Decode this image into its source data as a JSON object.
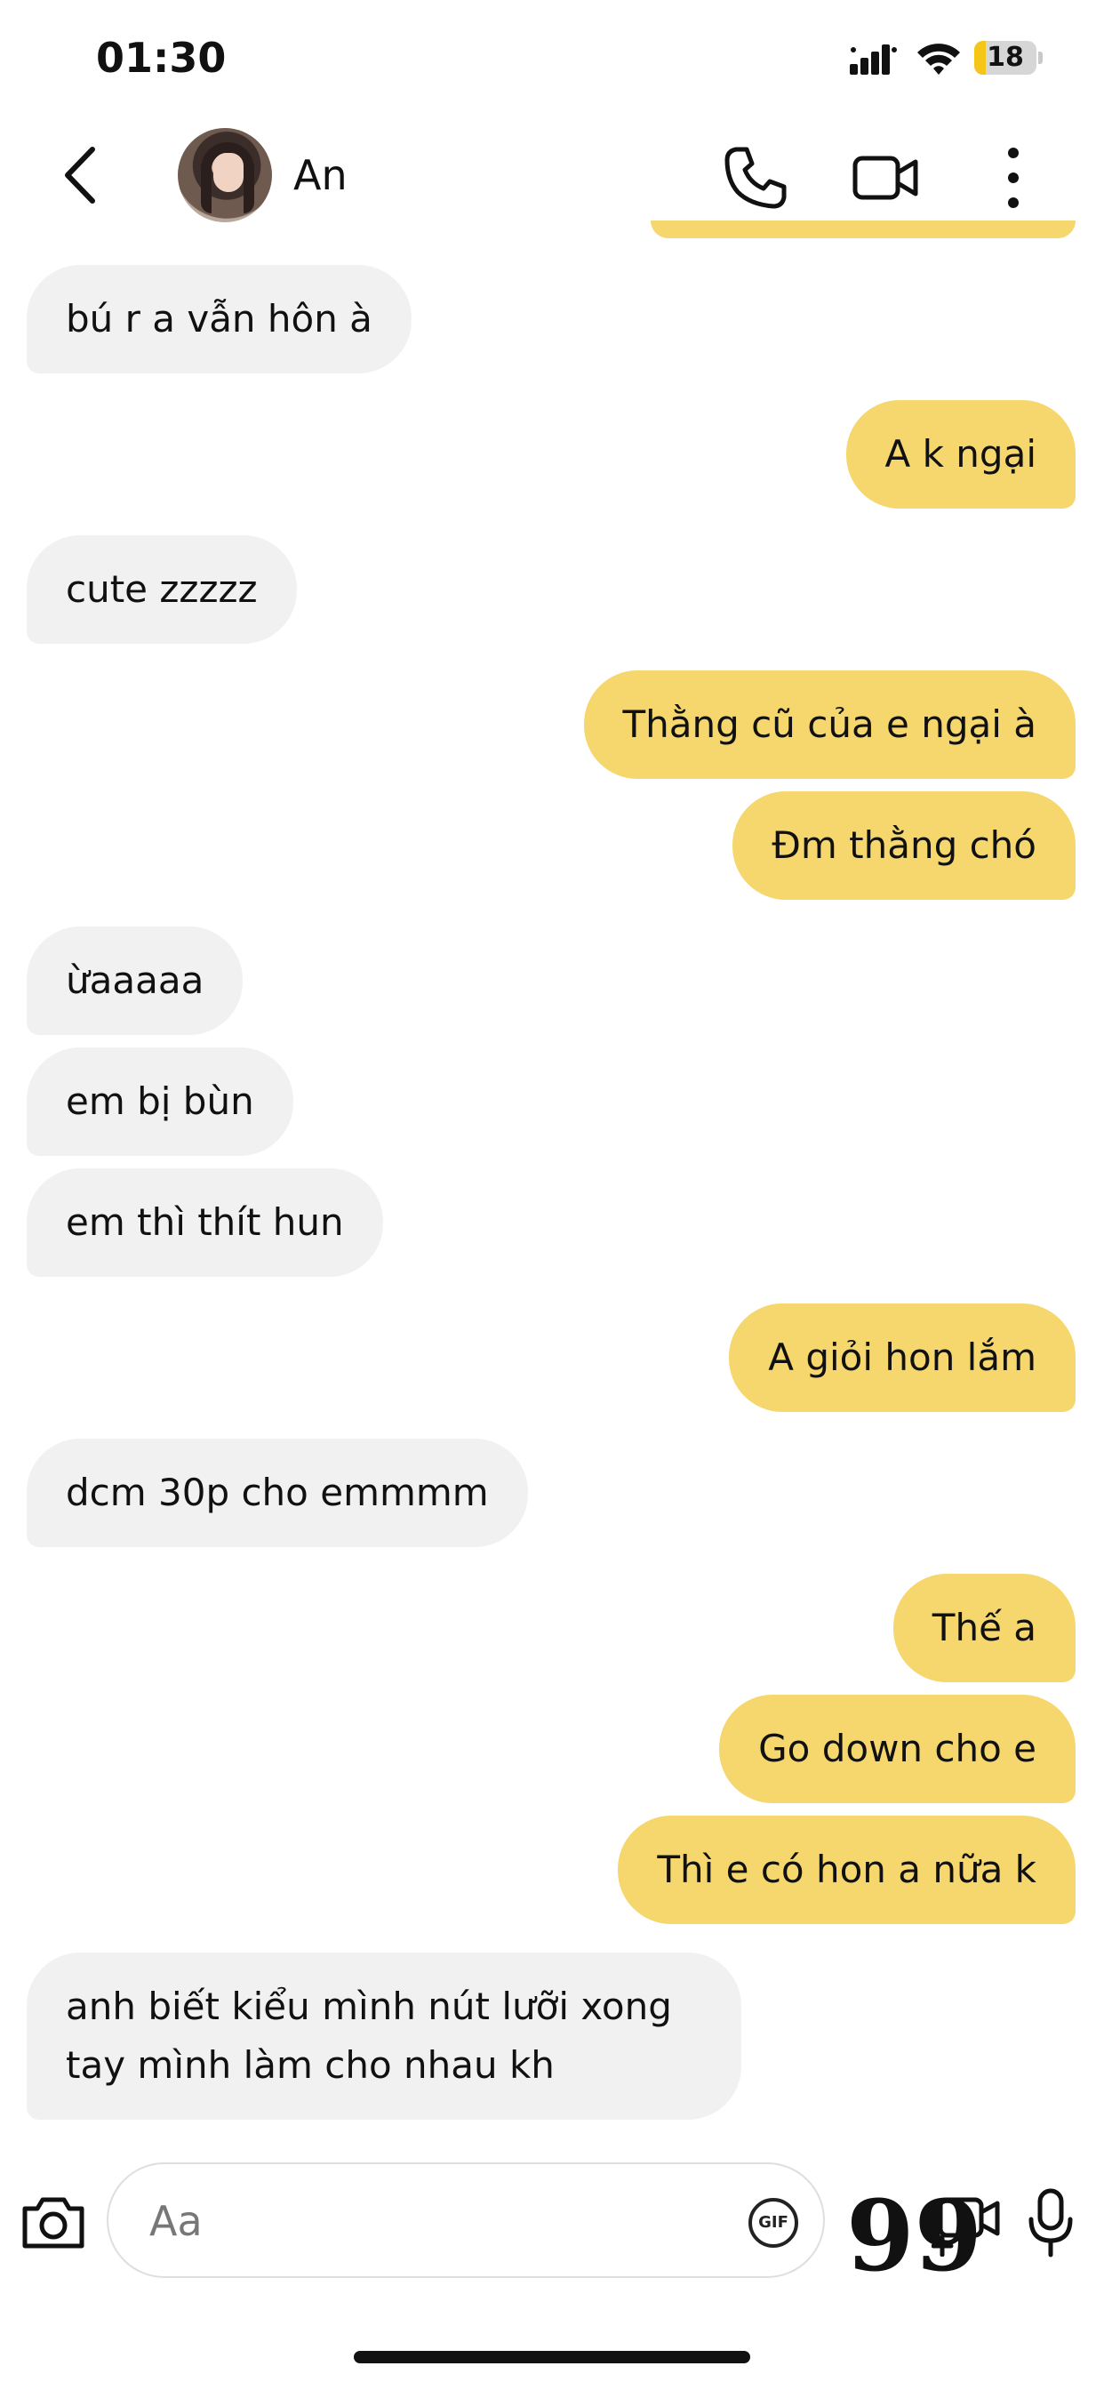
{
  "status_bar": {
    "time": "01:30",
    "battery_percent": 18,
    "battery_label": "18"
  },
  "header": {
    "contact_name": "An",
    "icons": [
      "back-icon",
      "avatar",
      "phone-icon",
      "video-camera-icon",
      "more-vertical-icon"
    ]
  },
  "messages": [
    {
      "side": "in",
      "text": "bú r a vẫn hôn à"
    },
    {
      "side": "out",
      "text": "A k ngại"
    },
    {
      "side": "in",
      "text": "cute zzzzz"
    },
    {
      "side": "out",
      "text": "Thằng cũ của e ngại à"
    },
    {
      "side": "out",
      "text": "Đm thằng chó"
    },
    {
      "side": "in",
      "text": "ừaaaaa"
    },
    {
      "side": "in",
      "text": "em bị bùn"
    },
    {
      "side": "in",
      "text": "em thì thít hun"
    },
    {
      "side": "out",
      "text": "A giỏi hon lắm"
    },
    {
      "side": "in",
      "text": "dcm 30p cho emmmm"
    },
    {
      "side": "out",
      "text": "Thế a"
    },
    {
      "side": "out",
      "text": "Go down cho e"
    },
    {
      "side": "out",
      "text": "Thì e có hon a nữa k"
    },
    {
      "side": "in",
      "text": "anh biết kiểu mình nút lưỡi xong tay mình làm cho nhau kh"
    }
  ],
  "composer": {
    "placeholder": "Aa",
    "gif_label": "GIF",
    "quote_glyph": "99",
    "icons": [
      "camera-icon",
      "gif-icon",
      "quote-icon",
      "media-icon",
      "microphone-icon"
    ]
  },
  "colors": {
    "outgoing_bubble": "#f5d76e",
    "incoming_bubble": "#f1f1f1",
    "battery_fill": "#f5c518"
  }
}
